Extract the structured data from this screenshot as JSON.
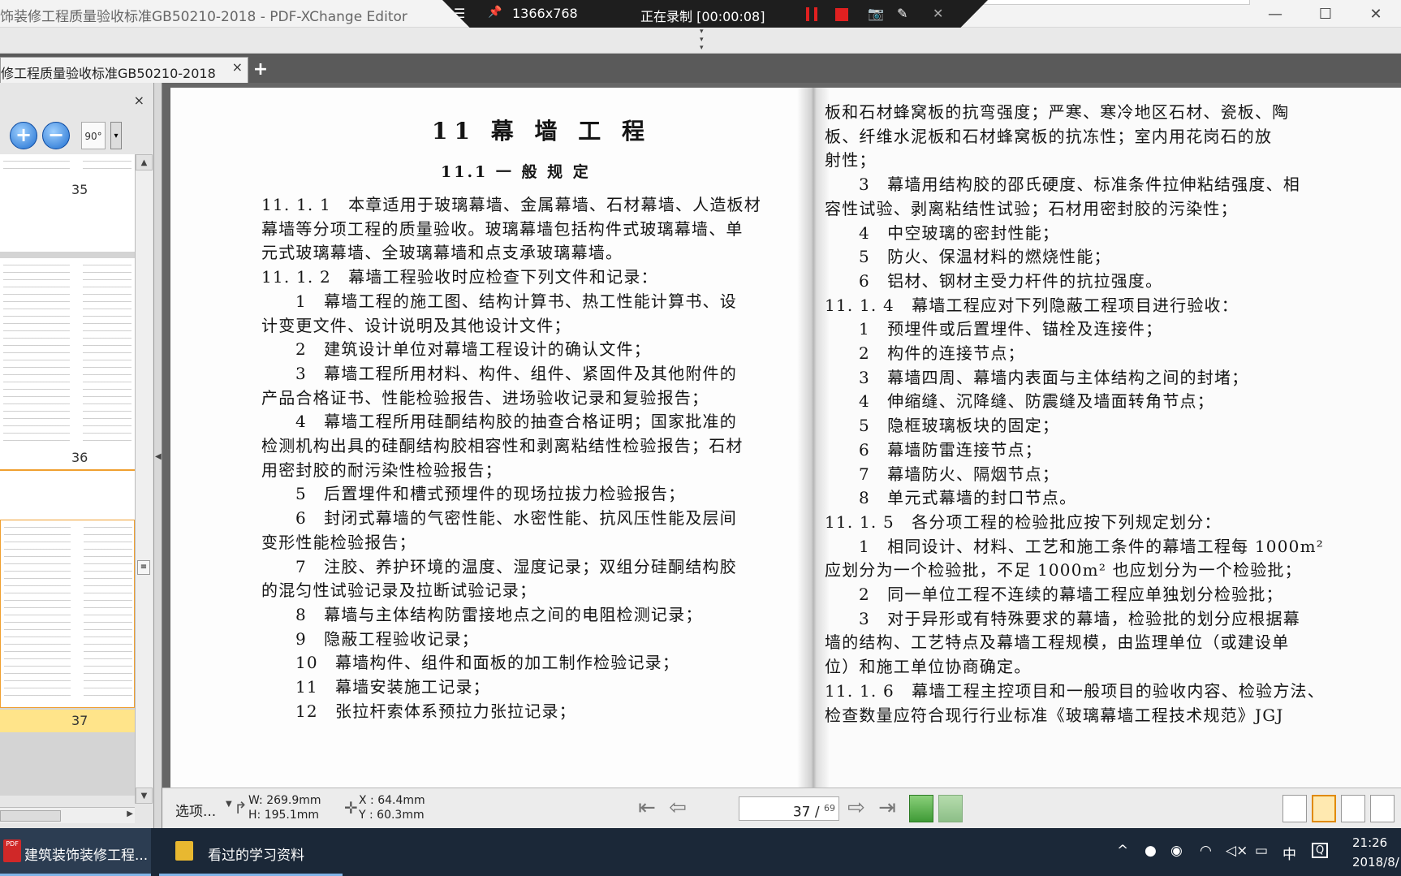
{
  "window": {
    "title": "饰装修工程质量验收标准GB50210-2018 - PDF-XChange Editor",
    "controls": {
      "minimize": "—",
      "maximize": "☐",
      "close": "✕"
    }
  },
  "recorder": {
    "menu_icon": "☰",
    "pin_icon": "📌",
    "resolution": "1366x768",
    "status": "正在录制 [00:00:08]",
    "camera_icon": "📷",
    "pen_icon": "✎",
    "close_icon": "✕"
  },
  "tabs": [
    {
      "label": "修工程质量验收标准GB50210-2018",
      "close": "×"
    }
  ],
  "tab_add": "+",
  "left_panel": {
    "close": "×",
    "zoom_in": "+",
    "zoom_out": "−",
    "rotate_label": "90°",
    "dropdown": "▾",
    "pages": [
      "35",
      "36",
      "37"
    ],
    "current_page": "37"
  },
  "document": {
    "left_page": {
      "chapter": "11  幕 墙 工 程",
      "section": "11.1  一 般 规 定",
      "lines": [
        {
          "text": "11. 1. 1　本章适用于玻璃幕墙、金属幕墙、石材幕墙、人造板材",
          "indent": 0
        },
        {
          "text": "幕墙等分项工程的质量验收。玻璃幕墙包括构件式玻璃幕墙、单",
          "indent": 0
        },
        {
          "text": "元式玻璃幕墙、全玻璃幕墙和点支承玻璃幕墙。",
          "indent": 0
        },
        {
          "text": "11. 1. 2　幕墙工程验收时应检查下列文件和记录：",
          "indent": 0
        },
        {
          "text": "1　幕墙工程的施工图、结构计算书、热工性能计算书、设",
          "indent": 1
        },
        {
          "text": "计变更文件、设计说明及其他设计文件；",
          "indent": 0
        },
        {
          "text": "2　建筑设计单位对幕墙工程设计的确认文件；",
          "indent": 1
        },
        {
          "text": "3　幕墙工程所用材料、构件、组件、紧固件及其他附件的",
          "indent": 1
        },
        {
          "text": "产品合格证书、性能检验报告、进场验收记录和复验报告；",
          "indent": 0
        },
        {
          "text": "4　幕墙工程所用硅酮结构胶的抽查合格证明；国家批准的",
          "indent": 1
        },
        {
          "text": "检测机构出具的硅酮结构胶相容性和剥离粘结性检验报告；石材",
          "indent": 0
        },
        {
          "text": "用密封胶的耐污染性检验报告；",
          "indent": 0
        },
        {
          "text": "5　后置埋件和槽式预埋件的现场拉拔力检验报告；",
          "indent": 1
        },
        {
          "text": "6　封闭式幕墙的气密性能、水密性能、抗风压性能及层间",
          "indent": 1
        },
        {
          "text": "变形性能检验报告；",
          "indent": 0
        },
        {
          "text": "7　注胶、养护环境的温度、湿度记录；双组分硅酮结构胶",
          "indent": 1
        },
        {
          "text": "的混匀性试验记录及拉断试验记录；",
          "indent": 0
        },
        {
          "text": "8　幕墙与主体结构防雷接地点之间的电阻检测记录；",
          "indent": 1
        },
        {
          "text": "9　隐蔽工程验收记录；",
          "indent": 1
        },
        {
          "text": "10　幕墙构件、组件和面板的加工制作检验记录；",
          "indent": 1
        },
        {
          "text": "11　幕墙安装施工记录；",
          "indent": 1
        },
        {
          "text": "12　张拉杆索体系预拉力张拉记录；",
          "indent": 1
        }
      ]
    },
    "right_page": {
      "lines": [
        {
          "text": "板和石材蜂窝板的抗弯强度；严寒、寒冷地区石材、瓷板、陶",
          "indent": 0
        },
        {
          "text": "板、纤维水泥板和石材蜂窝板的抗冻性；室内用花岗石的放",
          "indent": 0
        },
        {
          "text": "射性；",
          "indent": 0
        },
        {
          "text": "3　幕墙用结构胶的邵氏硬度、标准条件拉伸粘结强度、相",
          "indent": 1
        },
        {
          "text": "容性试验、剥离粘结性试验；石材用密封胶的污染性；",
          "indent": 0
        },
        {
          "text": "4　中空玻璃的密封性能；",
          "indent": 1
        },
        {
          "text": "5　防火、保温材料的燃烧性能；",
          "indent": 1
        },
        {
          "text": "6　铝材、钢材主受力杆件的抗拉强度。",
          "indent": 1
        },
        {
          "text": "11. 1. 4　幕墙工程应对下列隐蔽工程项目进行验收：",
          "indent": 0
        },
        {
          "text": "1　预埋件或后置埋件、锚栓及连接件；",
          "indent": 1
        },
        {
          "text": "2　构件的连接节点；",
          "indent": 1
        },
        {
          "text": "3　幕墙四周、幕墙内表面与主体结构之间的封堵；",
          "indent": 1
        },
        {
          "text": "4　伸缩缝、沉降缝、防震缝及墙面转角节点；",
          "indent": 1
        },
        {
          "text": "5　隐框玻璃板块的固定；",
          "indent": 1
        },
        {
          "text": "6　幕墙防雷连接节点；",
          "indent": 1
        },
        {
          "text": "7　幕墙防火、隔烟节点；",
          "indent": 1
        },
        {
          "text": "8　单元式幕墙的封口节点。",
          "indent": 1
        },
        {
          "text": "11. 1. 5　各分项工程的检验批应按下列规定划分：",
          "indent": 0
        },
        {
          "text": "1　相同设计、材料、工艺和施工条件的幕墙工程每 1000m²",
          "indent": 1
        },
        {
          "text": "应划分为一个检验批，不足 1000m² 也应划分为一个检验批；",
          "indent": 0
        },
        {
          "text": "2　同一单位工程不连续的幕墙工程应单独划分检验批；",
          "indent": 1
        },
        {
          "text": "3　对于异形或有特殊要求的幕墙，检验批的划分应根据幕",
          "indent": 1
        },
        {
          "text": "墙的结构、工艺特点及幕墙工程规模，由监理单位（或建设单",
          "indent": 0
        },
        {
          "text": "位）和施工单位协商确定。",
          "indent": 0
        },
        {
          "text": "11. 1. 6　幕墙工程主控项目和一般项目的验收内容、检验方法、",
          "indent": 0
        },
        {
          "text": "检查数量应符合现行行业标准《玻璃幕墙工程技术规范》JGJ",
          "indent": 0
        }
      ]
    }
  },
  "statusbar": {
    "options": "选项...",
    "width": "W: 269.9mm",
    "height": "H: 195.1mm",
    "x": "X :   64.4mm",
    "y": "Y :   60.3mm",
    "page_current": "37",
    "page_total": "69",
    "page_sep": " / "
  },
  "taskbar": {
    "apps": [
      {
        "label": "建筑装饰装修工程..."
      },
      {
        "label": "看过的学习资料"
      }
    ],
    "tray": {
      "chevron": "^",
      "ime": "中"
    },
    "clock_time": "21:26",
    "clock_date": "2018/8/"
  }
}
